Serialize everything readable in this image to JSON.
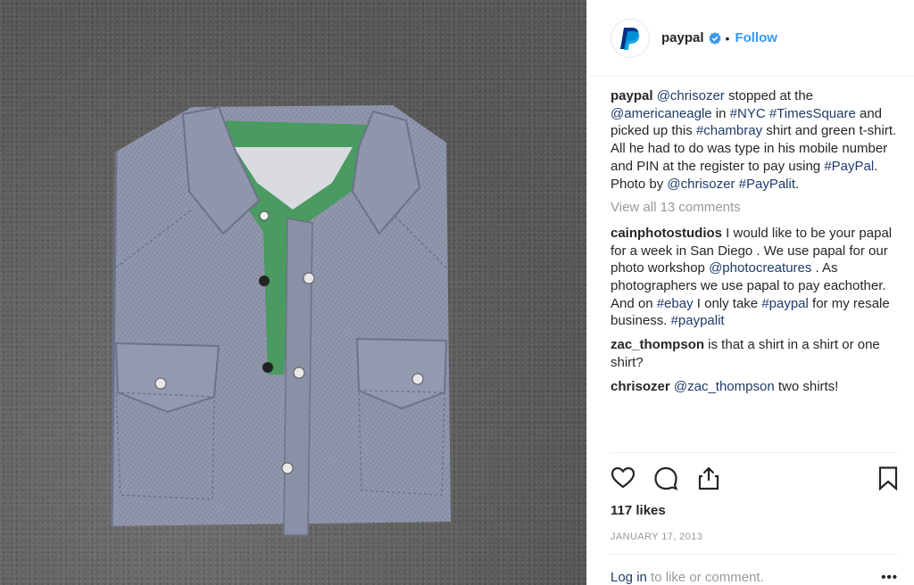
{
  "post": {
    "username": "paypal",
    "follow_label": "Follow",
    "separator": "•",
    "caption": {
      "user": "paypal",
      "segments": [
        {
          "text": "@chrisozer",
          "tag": true
        },
        {
          "text": " stopped at the ",
          "tag": false
        },
        {
          "text": "@americaneagle",
          "tag": true
        },
        {
          "text": " in ",
          "tag": false
        },
        {
          "text": "#NYC",
          "tag": true
        },
        {
          "text": " ",
          "tag": false
        },
        {
          "text": "#TimesSquare",
          "tag": true
        },
        {
          "text": " and picked up this ",
          "tag": false
        },
        {
          "text": "#chambray",
          "tag": true
        },
        {
          "text": " shirt and green t-shirt. All he had to do was type in his mobile number and PIN at the register to pay using ",
          "tag": false
        },
        {
          "text": "#PayPal",
          "tag": true
        },
        {
          "text": ". Photo by ",
          "tag": false
        },
        {
          "text": "@chrisozer",
          "tag": true
        },
        {
          "text": " ",
          "tag": false
        },
        {
          "text": "#PayPalit",
          "tag": true
        },
        {
          "text": ".",
          "tag": false
        }
      ]
    },
    "view_all_label": "View all 13 comments",
    "comments": [
      {
        "user": "cainphotostudios",
        "segments": [
          {
            "text": " I would like to be your papal for a week in San Diego . We use papal for our photo workshop ",
            "tag": false
          },
          {
            "text": "@photocreatures",
            "tag": true
          },
          {
            "text": " . As photographers we use papal to pay eachother. And on ",
            "tag": false
          },
          {
            "text": "#ebay",
            "tag": true
          },
          {
            "text": " I only take ",
            "tag": false
          },
          {
            "text": "#paypal",
            "tag": true
          },
          {
            "text": " for my resale business. ",
            "tag": false
          },
          {
            "text": "#paypalit",
            "tag": true
          }
        ]
      },
      {
        "user": "zac_thompson",
        "segments": [
          {
            "text": " is that a shirt in a shirt or one shirt?",
            "tag": false
          }
        ]
      },
      {
        "user": "chrisozer",
        "segments": [
          {
            "text": " ",
            "tag": false
          },
          {
            "text": "@zac_thompson",
            "tag": true
          },
          {
            "text": " two shirts!",
            "tag": false
          }
        ]
      }
    ],
    "likes": "117 likes",
    "date": "JANUARY 17, 2013",
    "login_label": "Log in",
    "login_suffix": " to like or comment.",
    "more_label": "•••"
  },
  "icons": {
    "avatar": "paypal-logo-icon",
    "verified": "verified-badge-icon",
    "like": "heart-icon",
    "comment": "comment-bubble-icon",
    "share": "share-icon",
    "save": "bookmark-icon"
  },
  "colors": {
    "link": "#1e3b6a",
    "follow": "#3897f0",
    "verified": "#3897f0",
    "muted": "#999999",
    "paypal_dark": "#003087",
    "paypal_light": "#009cde"
  }
}
